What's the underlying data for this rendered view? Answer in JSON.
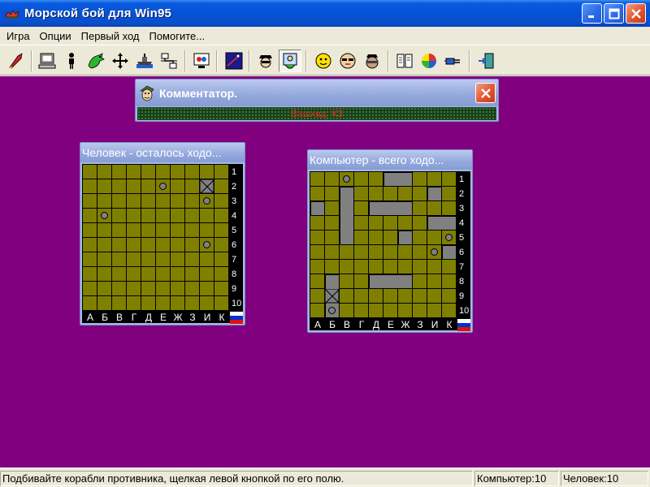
{
  "window": {
    "title": "Морской бой для Win95"
  },
  "menu": {
    "items": [
      "Игра",
      "Опции",
      "Первый ход",
      "Помогите..."
    ]
  },
  "toolbar": {
    "icons": [
      "rocket-icon",
      "computer-icon",
      "person-icon",
      "dragon-icon",
      "move-arrows-icon",
      "ship-icon",
      "network-icon",
      "two-players-icon",
      "sky-icon",
      "spy-icon",
      "painter-icon",
      "smiley-face-icon",
      "sunglasses-face-icon",
      "mask-face-icon",
      "help-book-icon",
      "color-wheel-icon",
      "plug-icon",
      "exit-door-icon"
    ]
  },
  "commentator": {
    "title": "Комментатор.",
    "message": "Вашхвд: К3"
  },
  "boards": {
    "human": {
      "title": "Человек - осталось ходо...",
      "rows": [
        "1",
        "2",
        "3",
        "4",
        "5",
        "6",
        "7",
        "8",
        "9",
        "10"
      ],
      "cols": [
        "А",
        "Б",
        "В",
        "Г",
        "Д",
        "Е",
        "Ж",
        "З",
        "И",
        "К"
      ],
      "misses": [
        [
          5,
          1
        ],
        [
          8,
          2
        ],
        [
          1,
          3
        ],
        [
          8,
          5
        ]
      ],
      "hits": [
        [
          8,
          1
        ]
      ],
      "ships": []
    },
    "computer": {
      "title": "Компьютер - всего ходо...",
      "rows": [
        "1",
        "2",
        "3",
        "4",
        "5",
        "6",
        "7",
        "8",
        "9",
        "10"
      ],
      "cols": [
        "А",
        "Б",
        "В",
        "Г",
        "Д",
        "Е",
        "Ж",
        "З",
        "И",
        "К"
      ],
      "misses": [
        [
          2,
          0
        ],
        [
          9,
          4
        ],
        [
          8,
          5
        ],
        [
          1,
          9
        ]
      ],
      "hits": [
        [
          1,
          8
        ]
      ],
      "ships": [
        {
          "col": 5,
          "row": 0,
          "len": 2,
          "dir": "h"
        },
        {
          "col": 8,
          "row": 1,
          "len": 1,
          "dir": "h"
        },
        {
          "col": 2,
          "row": 1,
          "len": 4,
          "dir": "v"
        },
        {
          "col": 0,
          "row": 2,
          "len": 1,
          "dir": "h"
        },
        {
          "col": 4,
          "row": 2,
          "len": 3,
          "dir": "h"
        },
        {
          "col": 8,
          "row": 3,
          "len": 2,
          "dir": "h"
        },
        {
          "col": 6,
          "row": 4,
          "len": 1,
          "dir": "h"
        },
        {
          "col": 9,
          "row": 5,
          "len": 1,
          "dir": "h"
        },
        {
          "col": 4,
          "row": 7,
          "len": 3,
          "dir": "h"
        },
        {
          "col": 1,
          "row": 7,
          "len": 3,
          "dir": "v"
        }
      ]
    }
  },
  "status": {
    "hint": "Подбивайте корабли противника, щелкая левой кнопкой по его полю.",
    "computer": "Компьютер:10",
    "human": "Человек:10"
  }
}
